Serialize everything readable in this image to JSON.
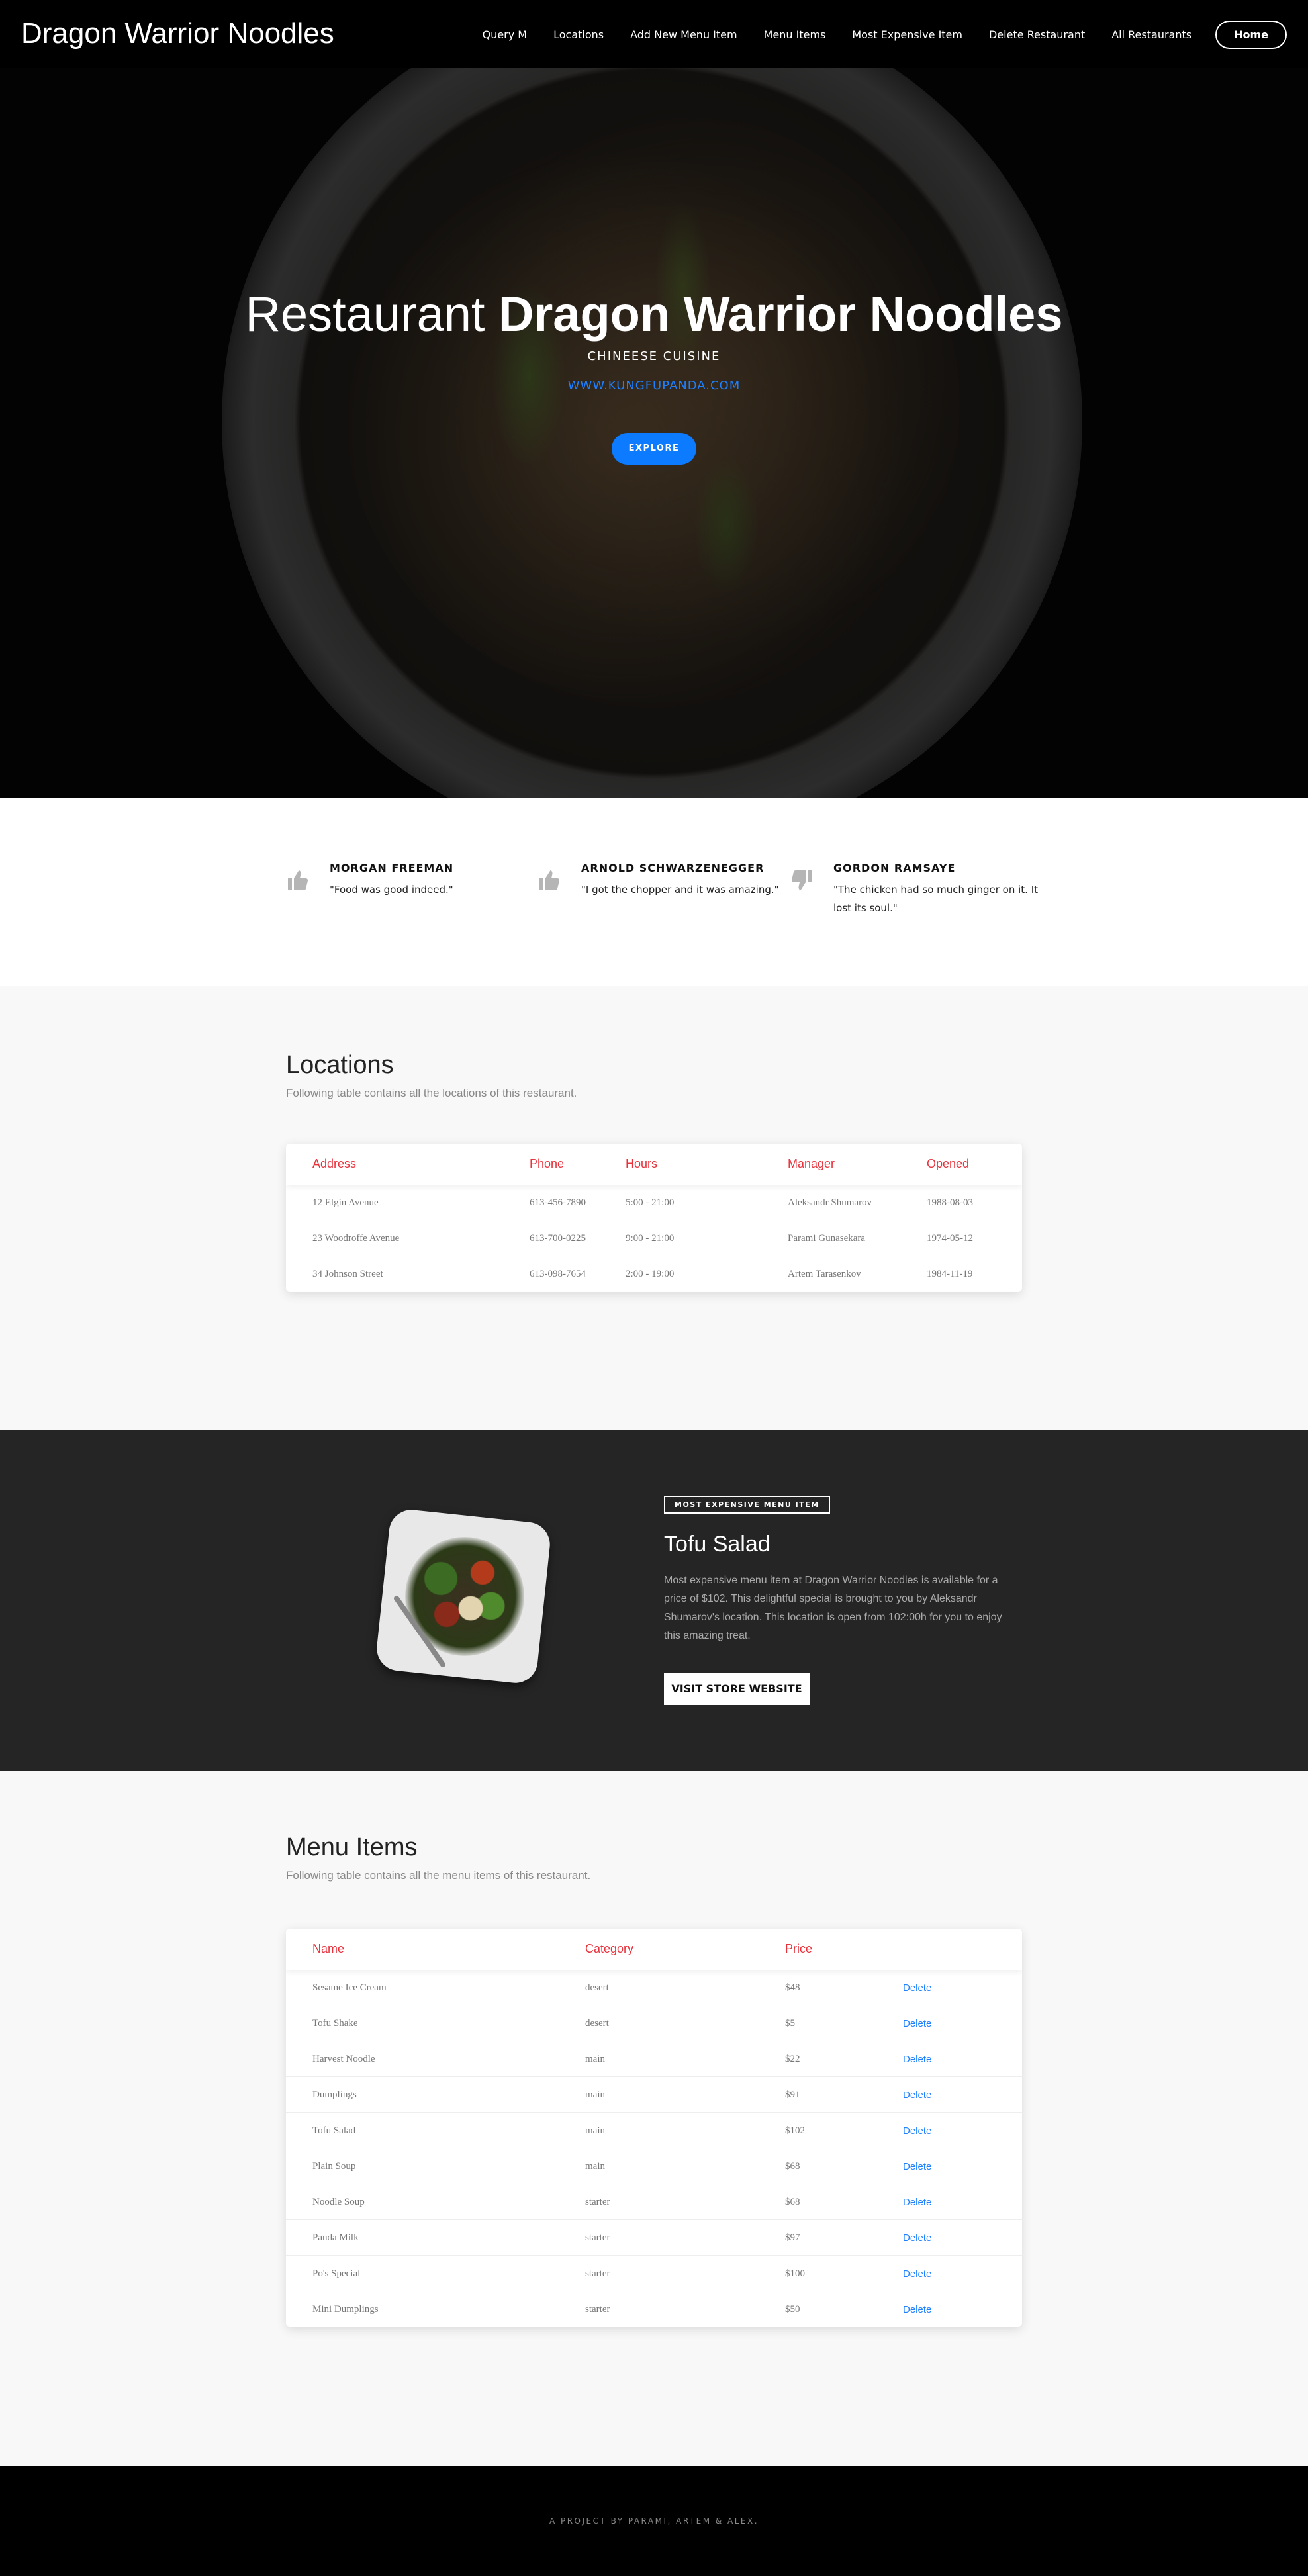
{
  "nav": {
    "brand": "Dragon Warrior Noodles",
    "links": [
      "Query M",
      "Locations",
      "Add New Menu Item",
      "Menu Items",
      "Most Expensive Item",
      "Delete Restaurant",
      "All Restaurants"
    ],
    "home": "Home"
  },
  "hero": {
    "title_prefix": "Restaurant",
    "title_name": "Dragon Warrior Noodles",
    "cuisine": "CHINEESE CUISINE",
    "url": "WWW.KUNGFUPANDA.COM",
    "button": "EXPLORE"
  },
  "reviews": [
    {
      "name": "MORGAN FREEMAN",
      "text": "\"Food was good indeed.\"",
      "icon": "thumbs-up-icon"
    },
    {
      "name": "ARNOLD SCHWARZENEGGER",
      "text": "\"I got the chopper and it was amazing.\"",
      "icon": "thumbs-up-icon"
    },
    {
      "name": "GORDON RAMSAYE",
      "text": "\"The chicken had so much ginger on it. It lost its soul.\"",
      "icon": "thumbs-down-icon"
    }
  ],
  "locations": {
    "title": "Locations",
    "subtitle": "Following table contains all the locations of this restaurant.",
    "headers": [
      "Address",
      "Phone",
      "Hours",
      "Manager",
      "Opened"
    ],
    "rows": [
      [
        "12 Elgin Avenue",
        "613-456-7890",
        "5:00 - 21:00",
        "Aleksandr Shumarov",
        "1988-08-03"
      ],
      [
        "23 Woodroffe Avenue",
        "613-700-0225",
        "9:00 - 21:00",
        "Parami Gunasekara",
        "1974-05-12"
      ],
      [
        "34 Johnson Street",
        "613-098-7654",
        "2:00 - 19:00",
        "Artem Tarasenkov",
        "1984-11-19"
      ]
    ]
  },
  "feature": {
    "tag": "MOST EXPENSIVE MENU ITEM",
    "title": "Tofu Salad",
    "description": "Most expensive menu item at Dragon Warrior Noodles is available for a price of $102. This delightful special is brought to you by Aleksandr Shumarov's location. This location is open from 102:00h for you to enjoy this amazing treat.",
    "button": "VISIT STORE WEBSITE"
  },
  "menu": {
    "title": "Menu Items",
    "subtitle": "Following table contains all the menu items of this restaurant.",
    "headers": [
      "Name",
      "Category",
      "Price"
    ],
    "delete_label": "Delete",
    "rows": [
      [
        "Sesame Ice Cream",
        "desert",
        "$48"
      ],
      [
        "Tofu Shake",
        "desert",
        "$5"
      ],
      [
        "Harvest Noodle",
        "main",
        "$22"
      ],
      [
        "Dumplings",
        "main",
        "$91"
      ],
      [
        "Tofu Salad",
        "main",
        "$102"
      ],
      [
        "Plain Soup",
        "main",
        "$68"
      ],
      [
        "Noodle Soup",
        "starter",
        "$68"
      ],
      [
        "Panda Milk",
        "starter",
        "$97"
      ],
      [
        "Po's Special",
        "starter",
        "$100"
      ],
      [
        "Mini Dumplings",
        "starter",
        "$50"
      ]
    ]
  },
  "footer": {
    "text": "A PROJECT BY PARAMI, ARTEM & ALEX."
  },
  "colors": {
    "accent_blue": "#0d7bff",
    "header_red": "#e8323c",
    "dark_section": "#252525"
  }
}
